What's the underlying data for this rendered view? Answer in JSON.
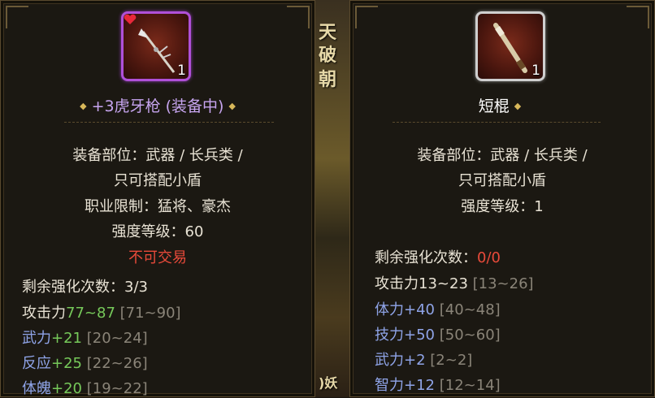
{
  "background": {
    "chars": [
      "天",
      "破",
      "朝",
      ")妖"
    ]
  },
  "left_item": {
    "quantity": "1",
    "name": "+3虎牙枪 (装备中)",
    "lines": [
      "装备部位：武器 / 长兵类 /",
      "只可搭配小盾",
      "职业限制：猛将、豪杰",
      "强度等级：60"
    ],
    "untradable": "不可交易",
    "enhance_label": "剩余强化次数：",
    "enhance_value": "3/3",
    "stats": [
      {
        "name": "攻击力",
        "value": "77~87",
        "range": "[71~90]"
      },
      {
        "name": "武力",
        "value": "+21",
        "range": "[20~24]"
      },
      {
        "name": "反应",
        "value": "+25",
        "range": "[22~26]"
      },
      {
        "name": "体魄",
        "value": "+20",
        "range": "[19~22]"
      }
    ]
  },
  "right_item": {
    "quantity": "1",
    "name": "短棍",
    "lines": [
      "装备部位：武器 / 长兵类 /",
      "只可搭配小盾",
      "强度等级：1"
    ],
    "enhance_label": "剩余强化次数：",
    "enhance_value": "0/0",
    "stats": [
      {
        "name": "攻击力13~23",
        "value": "",
        "range": "[13~26]"
      },
      {
        "name": "体力",
        "value": "+40",
        "range": "[40~48]"
      },
      {
        "name": "技力",
        "value": "+50",
        "range": "[50~60]"
      },
      {
        "name": "武力",
        "value": "+2",
        "range": "[2~2]"
      },
      {
        "name": "智力",
        "value": "+12",
        "range": "[12~14]"
      }
    ]
  },
  "colors": {
    "epic_border": "#b050d8",
    "epic_name": "#c7a5f0",
    "bonus": "#76c95a",
    "stat_blue": "#8fa4e8",
    "warn": "#e84a3a"
  }
}
